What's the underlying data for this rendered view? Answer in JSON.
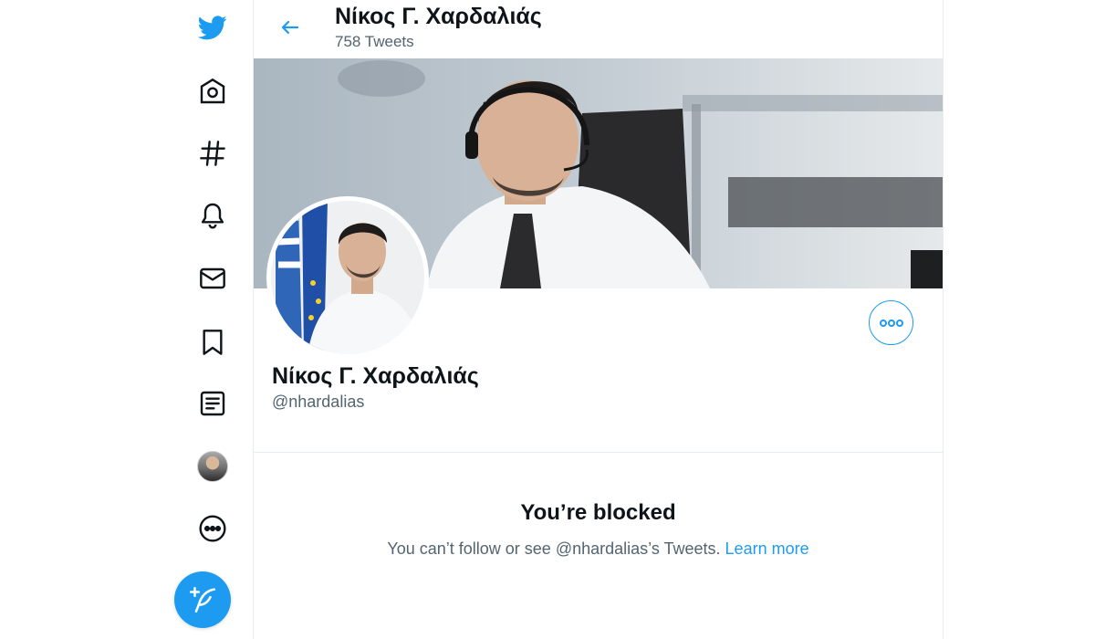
{
  "nav": {
    "items": [
      {
        "name": "twitter-logo-icon"
      },
      {
        "name": "home-icon"
      },
      {
        "name": "explore-hashtag-icon"
      },
      {
        "name": "notifications-bell-icon"
      },
      {
        "name": "messages-envelope-icon"
      },
      {
        "name": "bookmarks-icon"
      },
      {
        "name": "lists-icon"
      },
      {
        "name": "profile-avatar-icon"
      },
      {
        "name": "more-options-icon"
      }
    ],
    "compose": {
      "name": "compose-tweet-icon"
    }
  },
  "header": {
    "title": "Νίκος Γ. Χαρδαλιάς",
    "tweet_count": "758 Tweets"
  },
  "profile": {
    "name": "Νίκος Γ. Χαρδαλιάς",
    "handle": "@nhardalias"
  },
  "blocked": {
    "title": "You’re blocked",
    "message": "You can’t follow or see @nhardalias’s Tweets.",
    "link": "Learn more"
  },
  "colors": {
    "accent": "#1d9bf0",
    "text": "#0f1419",
    "secondary": "#536471",
    "border": "#e6ecf0"
  }
}
